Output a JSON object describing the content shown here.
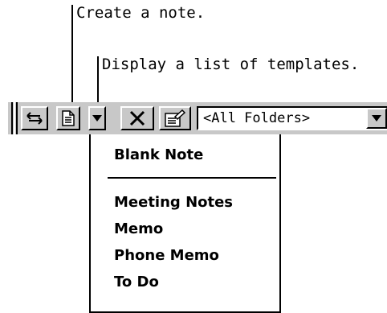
{
  "callouts": {
    "create_note": "Create a note.",
    "templates_list": "Display a list of templates."
  },
  "toolbar": {
    "items": [
      {
        "name": "grip-handle",
        "icon": "grip-icon"
      },
      {
        "name": "sync-button",
        "icon": "double-arrow-icon"
      },
      {
        "name": "new-note-button",
        "icon": "document-icon"
      },
      {
        "name": "template-dropdown-button",
        "icon": "down-arrow-icon"
      },
      {
        "name": "delete-button",
        "icon": "x-icon"
      },
      {
        "name": "properties-button",
        "icon": "properties-icon"
      }
    ],
    "folder_select": {
      "value": "<All Folders>",
      "icon": "down-arrow-icon"
    }
  },
  "template_menu": {
    "items": [
      "Blank Note",
      "Meeting Notes",
      "Memo",
      "Phone Memo",
      "To Do"
    ]
  },
  "colors": {
    "toolbar_bg": "#c8c8c8",
    "highlight": "#ffffff",
    "shadow": "#000000"
  }
}
